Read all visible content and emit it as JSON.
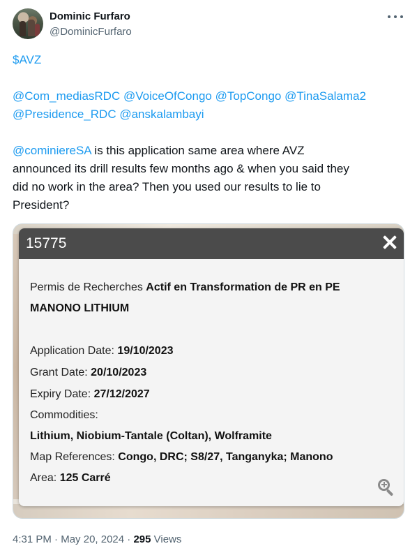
{
  "author": {
    "name": "Dominic Furfaro",
    "handle": "@DominicFurfaro"
  },
  "tweet": {
    "cashtag": "$AVZ",
    "mentions_line1": [
      "@Com_mediasRDC",
      "@VoiceOfCongo",
      "@TopCongo",
      "@TinaSalama2"
    ],
    "mentions_line2": [
      "@Presidence_RDC",
      "@anskalambayi"
    ],
    "reply_mention": "@cominiereSA",
    "text_line1": " is this application same area where AVZ",
    "text_line2": "announced its drill results few months ago & when you said they",
    "text_line3": "did no work in the area? Then you used our results to lie to",
    "text_line4": "President?"
  },
  "popup": {
    "title": "15775",
    "permit_label": "Permis de Recherches",
    "permit_status": "Actif en Transformation de PR en PE",
    "company": "MANONO LITHIUM",
    "application_date_label": "Application Date:",
    "application_date": "19/10/2023",
    "grant_date_label": "Grant Date:",
    "grant_date": "20/10/2023",
    "expiry_date_label": "Expiry Date:",
    "expiry_date": "27/12/2027",
    "commodities_label": "Commodities:",
    "commodities": "Lithium, Niobium-Tantale (Coltan), Wolframite",
    "map_references_label": "Map References:",
    "map_references": "Congo, DRC; S8/27, Tanganyka; Manono",
    "area_label": "Area:",
    "area": "125 Carré"
  },
  "footer": {
    "time": "4:31 PM",
    "sep1": " · ",
    "date": "May 20, 2024",
    "sep2": " · ",
    "views_count": "295",
    "views_label": " Views"
  }
}
